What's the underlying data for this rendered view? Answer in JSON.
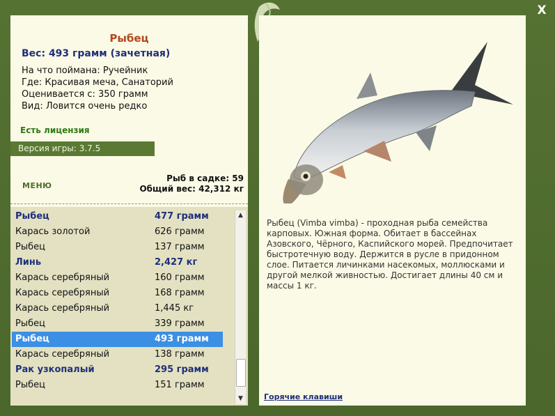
{
  "window": {
    "close_label": "X"
  },
  "fish": {
    "title": "Рыбец",
    "weight": "Вес: 493 грамм (зачетная)",
    "caught_with": "На что поймана: Ручейник",
    "location": "Где: Красивая меча, Санаторий",
    "rated_from": "Оценивается с: 350 грамм",
    "rarity": "Вид: Ловится очень редко"
  },
  "license": "Есть лицензия",
  "version": "Версия игры: 3.7.5",
  "menu_label": "МЕНЮ",
  "keepnet": {
    "count": "Рыб в садке: 59",
    "total": "Общий вес: 42,312 кг"
  },
  "catch_list": [
    {
      "name": "Рыбец",
      "weight": "477 грамм",
      "highlight": true
    },
    {
      "name": "Карась золотой",
      "weight": "626 грамм"
    },
    {
      "name": "Рыбец",
      "weight": "137 грамм"
    },
    {
      "name": "Линь",
      "weight": "2,427 кг",
      "highlight": true
    },
    {
      "name": "Карась серебряный",
      "weight": "160 грамм"
    },
    {
      "name": "Карась серебряный",
      "weight": "168 грамм"
    },
    {
      "name": "Карась серебряный",
      "weight": "1,445 кг"
    },
    {
      "name": "Рыбец",
      "weight": "339 грамм"
    },
    {
      "name": "Рыбец",
      "weight": "493 грамм",
      "selected": true
    },
    {
      "name": "Карась серебряный",
      "weight": "138 грамм"
    },
    {
      "name": "Рак узкопалый",
      "weight": "295 грамм",
      "highlight": true
    },
    {
      "name": "Рыбец",
      "weight": "151 грамм"
    }
  ],
  "description": "Рыбец (Vimba vimba) - проходная рыба семейства карповых. Южная форма. Обитает в бассейнах Азовского, Чёрного, Каспийского морей. Предпочитает быстротечную воду. Держится в русле в придонном слое. Питается личинками насекомых, моллюсками и другой мелкой живностью. Достигает длины 40 см и массы 1 кг.",
  "hotkeys_label": "Горячие клавиши",
  "colors": {
    "frame": "#557233",
    "panel": "#fbfae6",
    "selected": "#3b8fe4",
    "title": "#b2481d",
    "accent_text": "#1f2f7a"
  }
}
